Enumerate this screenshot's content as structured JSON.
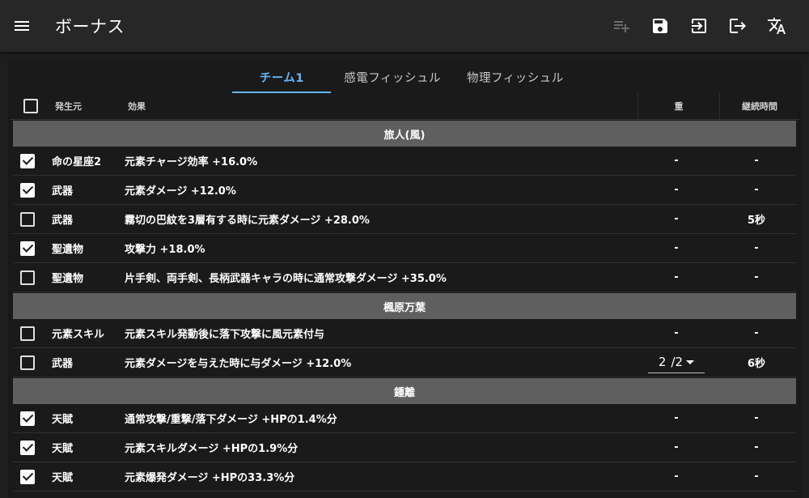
{
  "appbar": {
    "title": "ボーナス"
  },
  "tabs": [
    "チーム1",
    "感電フィッシュル",
    "物理フィッシュル"
  ],
  "table": {
    "headers": {
      "source": "発生元",
      "effect": "効果",
      "weight": "重",
      "duration": "継続時間"
    },
    "groups": [
      {
        "name": "旅人(風)",
        "rows": [
          {
            "checked": true,
            "source": "命の星座2",
            "effect": "元素チャージ効率 +16.0%",
            "weight": "-",
            "duration": "-"
          },
          {
            "checked": true,
            "source": "武器",
            "effect": "元素ダメージ +12.0%",
            "weight": "-",
            "duration": "-"
          },
          {
            "checked": false,
            "source": "武器",
            "effect": "霧切の巴紋を3層有する時に元素ダメージ +28.0%",
            "weight": "-",
            "duration": "5秒"
          },
          {
            "checked": true,
            "source": "聖遺物",
            "effect": "攻撃力 +18.0%",
            "weight": "-",
            "duration": "-"
          },
          {
            "checked": false,
            "source": "聖遺物",
            "effect": "片手剣、両手剣、長柄武器キャラの時に通常攻撃ダメージ +35.0%",
            "weight": "-",
            "duration": "-"
          }
        ]
      },
      {
        "name": "楓原万葉",
        "rows": [
          {
            "checked": false,
            "source": "元素スキル",
            "effect": "元素スキル発動後に落下攻撃に風元素付与",
            "weight": "-",
            "duration": "-"
          },
          {
            "checked": false,
            "source": "武器",
            "effect": "元素ダメージを与えた時に与ダメージ +12.0%",
            "weight_select": {
              "value": "2",
              "max": "/2"
            },
            "duration": "6秒"
          }
        ]
      },
      {
        "name": "鍾離",
        "rows": [
          {
            "checked": true,
            "source": "天賦",
            "effect": "通常攻撃/重撃/落下ダメージ +HPの1.4%分",
            "weight": "-",
            "duration": "-"
          },
          {
            "checked": true,
            "source": "天賦",
            "effect": "元素スキルダメージ +HPの1.9%分",
            "weight": "-",
            "duration": "-"
          },
          {
            "checked": true,
            "source": "天賦",
            "effect": "元素爆発ダメージ +HPの33.3%分",
            "weight": "-",
            "duration": "-"
          }
        ]
      }
    ]
  }
}
